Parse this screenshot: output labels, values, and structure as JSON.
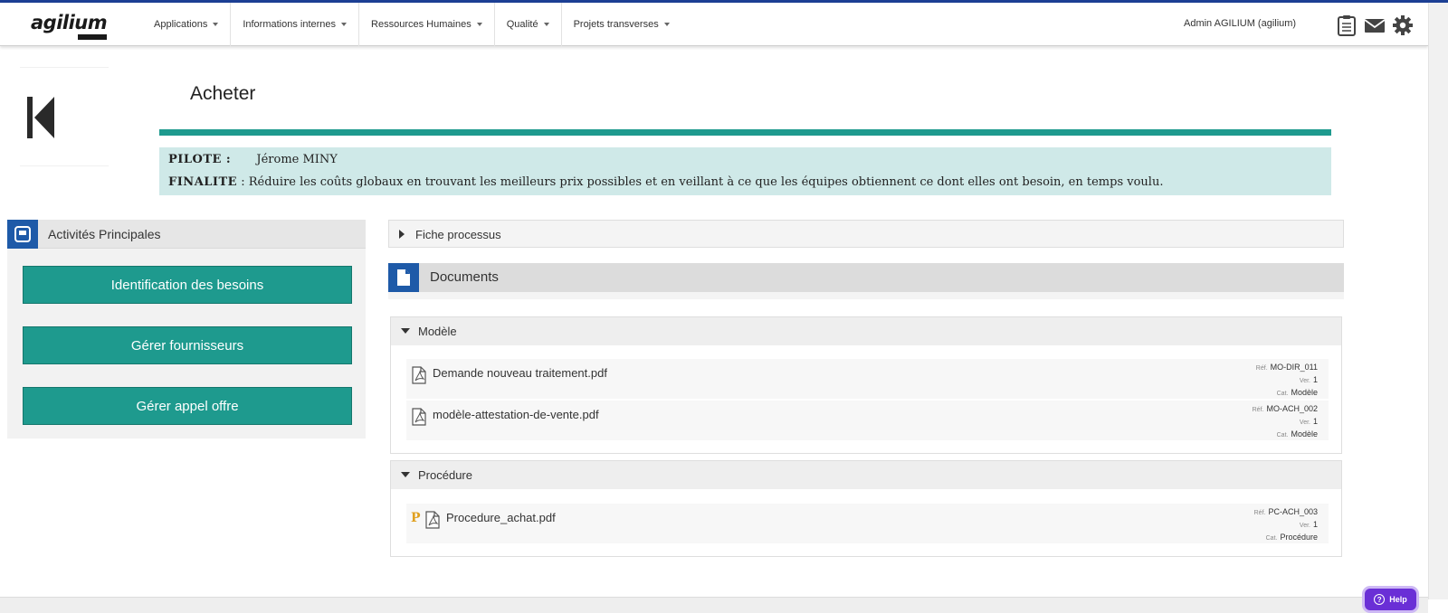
{
  "header": {
    "logo": "agilium",
    "menus": [
      {
        "label": "Applications"
      },
      {
        "label": "Informations internes"
      },
      {
        "label": "Ressources Humaines"
      },
      {
        "label": "Qualité"
      },
      {
        "label": "Projets transverses"
      }
    ],
    "user": "Admin AGILIUM (agilium)",
    "icons": [
      "clipboard-icon",
      "mail-icon",
      "gear-icon"
    ]
  },
  "page": {
    "title": "Acheter",
    "pilote_label": "PILOTE :",
    "pilote_value": "Jérome MINY",
    "finalite_label": "FINALITE",
    "finalite_value": ": Réduire les coûts globaux en trouvant les meilleurs prix possibles et en veillant à ce que les équipes obtiennent ce dont elles ont besoin, en temps voulu."
  },
  "activities": {
    "title": "Activités Principales",
    "buttons": [
      {
        "label": "Identification des besoins"
      },
      {
        "label": "Gérer fournisseurs"
      },
      {
        "label": "Gérer appel offre"
      }
    ]
  },
  "fiche": {
    "label": "Fiche processus"
  },
  "documents": {
    "title": "Documents",
    "meta_keys": {
      "ref": "Réf.",
      "ver": "Ver.",
      "cat": "Cat."
    },
    "groups": [
      {
        "label": "Modèle",
        "items": [
          {
            "name": "Demande nouveau traitement.pdf",
            "ref": "MO-DIR_011",
            "ver": "1",
            "cat": "Modèle"
          },
          {
            "name": "modèle-attestation-de-vente.pdf",
            "ref": "MO-ACH_002",
            "ver": "1",
            "cat": "Modèle"
          }
        ]
      },
      {
        "label": "Procédure",
        "items": [
          {
            "name": "Procedure_achat.pdf",
            "ref": "PC-ACH_003",
            "ver": "1",
            "cat": "Procédure",
            "mark": "P"
          }
        ]
      }
    ]
  },
  "help": {
    "label": "Help"
  },
  "colors": {
    "teal": "#1e9a8e",
    "blue": "#1e5aa8",
    "info_bg": "#cfe9e8",
    "help": "#6a2fd6"
  }
}
